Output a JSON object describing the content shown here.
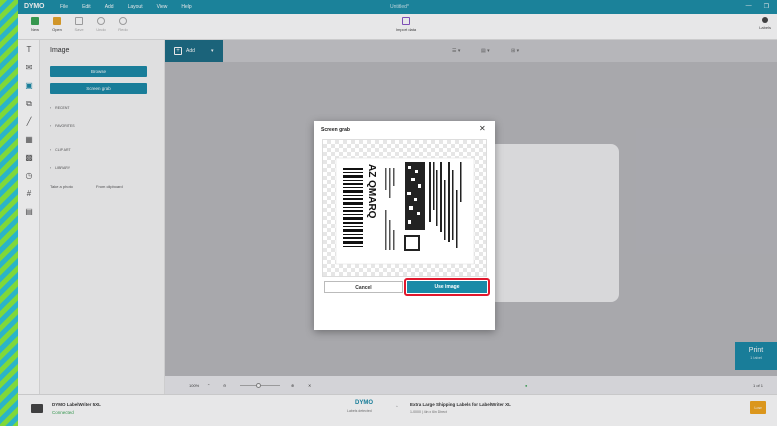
{
  "titlebar": {
    "logo": "DYMO",
    "menus": [
      "File",
      "Edit",
      "Add",
      "Layout",
      "View",
      "Help"
    ],
    "doc_title": "Untitled*",
    "controls": {
      "minimize": "—",
      "restore": "❐"
    }
  },
  "toolbar": {
    "tools": [
      {
        "label": "New",
        "color": "#3aa655",
        "disabled": false
      },
      {
        "label": "Open",
        "color": "#e7a52b",
        "disabled": false
      },
      {
        "label": "Save",
        "color": "#9aa0a6",
        "disabled": true
      },
      {
        "label": "Undo",
        "color": "#9aa0a6",
        "disabled": true
      },
      {
        "label": "Redo",
        "color": "#9aa0a6",
        "disabled": true
      }
    ],
    "import_label": "Import data",
    "labels_label": "Labels"
  },
  "side_icons": [
    "T",
    "✉",
    "▣",
    "⧉",
    "╱",
    "▦",
    "▩",
    "◷",
    "#",
    "▤"
  ],
  "panel": {
    "title": "Image",
    "browse_label": "Browse",
    "screen_grab_label": "Screen grab",
    "sections": [
      "RECENT",
      "FAVORITES",
      "CLIP ART",
      "LIBRARY"
    ],
    "take_photo": "Take a photo",
    "from_clipboard": "From clipboard"
  },
  "canvas_toolbar": {
    "add_label": "Add",
    "add_icon": "+",
    "add_caret": "▾"
  },
  "print": {
    "label": "Print",
    "sub": "1 label"
  },
  "zoom": {
    "level": "100%",
    "label_count": "1 of 1"
  },
  "status": {
    "printer_name": "DYMO LabelWriter 5XL",
    "printer_state": "Connected",
    "brand": "DYMO",
    "brand_sub": "Labels detected",
    "label_name": "Extra Large Shipping Labels for LabelWriter XL",
    "label_sub": "1-0000 | 4in x 6in Direct",
    "badge": "Low stock"
  },
  "dialog": {
    "title": "Screen grab",
    "close": "✕",
    "cancel_label": "Cancel",
    "use_image_label": "Use image",
    "image_text": "AZ QMARQ"
  },
  "colors": {
    "accent": "#1a8aa7",
    "titlebar": "#1c8fa9",
    "highlight": "#e0182d"
  }
}
